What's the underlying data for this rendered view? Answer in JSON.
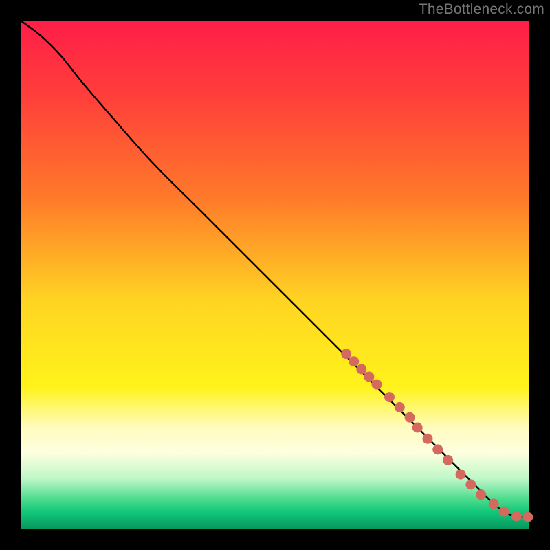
{
  "watermark": "TheBottleneck.com",
  "chart_data": {
    "type": "line",
    "title": "",
    "xlabel": "",
    "ylabel": "",
    "xlim": [
      0,
      100
    ],
    "ylim": [
      0,
      100
    ],
    "gradient_stops": [
      {
        "offset": 0,
        "color": "#ff1e48"
      },
      {
        "offset": 0.15,
        "color": "#ff3f3a"
      },
      {
        "offset": 0.35,
        "color": "#ff7a2a"
      },
      {
        "offset": 0.55,
        "color": "#ffd423"
      },
      {
        "offset": 0.72,
        "color": "#fff31a"
      },
      {
        "offset": 0.8,
        "color": "#fffbc0"
      },
      {
        "offset": 0.85,
        "color": "#fdffe0"
      },
      {
        "offset": 0.9,
        "color": "#bff7c8"
      },
      {
        "offset": 0.94,
        "color": "#4edc8f"
      },
      {
        "offset": 0.965,
        "color": "#12c87a"
      },
      {
        "offset": 0.99,
        "color": "#0aa566"
      },
      {
        "offset": 1.0,
        "color": "#07955b"
      }
    ],
    "series": [
      {
        "name": "main-curve",
        "x": [
          0,
          4,
          8,
          12,
          18,
          26,
          36,
          48,
          60,
          72,
          80,
          86,
          90,
          93,
          95,
          97,
          98,
          100
        ],
        "y": [
          100,
          97,
          93,
          88,
          81,
          72,
          62,
          50,
          38,
          26,
          18,
          12,
          8,
          5,
          3.5,
          2.6,
          2.4,
          2.4
        ]
      }
    ],
    "scatter": {
      "name": "highlight-dots",
      "color": "#d46a5e",
      "radius": 7.5,
      "points": [
        {
          "x": 64.0,
          "y": 34.5
        },
        {
          "x": 65.5,
          "y": 33.0
        },
        {
          "x": 67.0,
          "y": 31.5
        },
        {
          "x": 68.5,
          "y": 30.0
        },
        {
          "x": 70.0,
          "y": 28.5
        },
        {
          "x": 72.5,
          "y": 26.0
        },
        {
          "x": 74.5,
          "y": 24.0
        },
        {
          "x": 76.5,
          "y": 22.0
        },
        {
          "x": 78.0,
          "y": 20.0
        },
        {
          "x": 80.0,
          "y": 17.8
        },
        {
          "x": 82.0,
          "y": 15.7
        },
        {
          "x": 84.0,
          "y": 13.6
        },
        {
          "x": 86.5,
          "y": 10.8
        },
        {
          "x": 88.5,
          "y": 8.8
        },
        {
          "x": 90.5,
          "y": 6.8
        },
        {
          "x": 93.0,
          "y": 5.0
        },
        {
          "x": 95.0,
          "y": 3.5
        },
        {
          "x": 97.5,
          "y": 2.6
        },
        {
          "x": 99.7,
          "y": 2.4
        }
      ]
    }
  }
}
